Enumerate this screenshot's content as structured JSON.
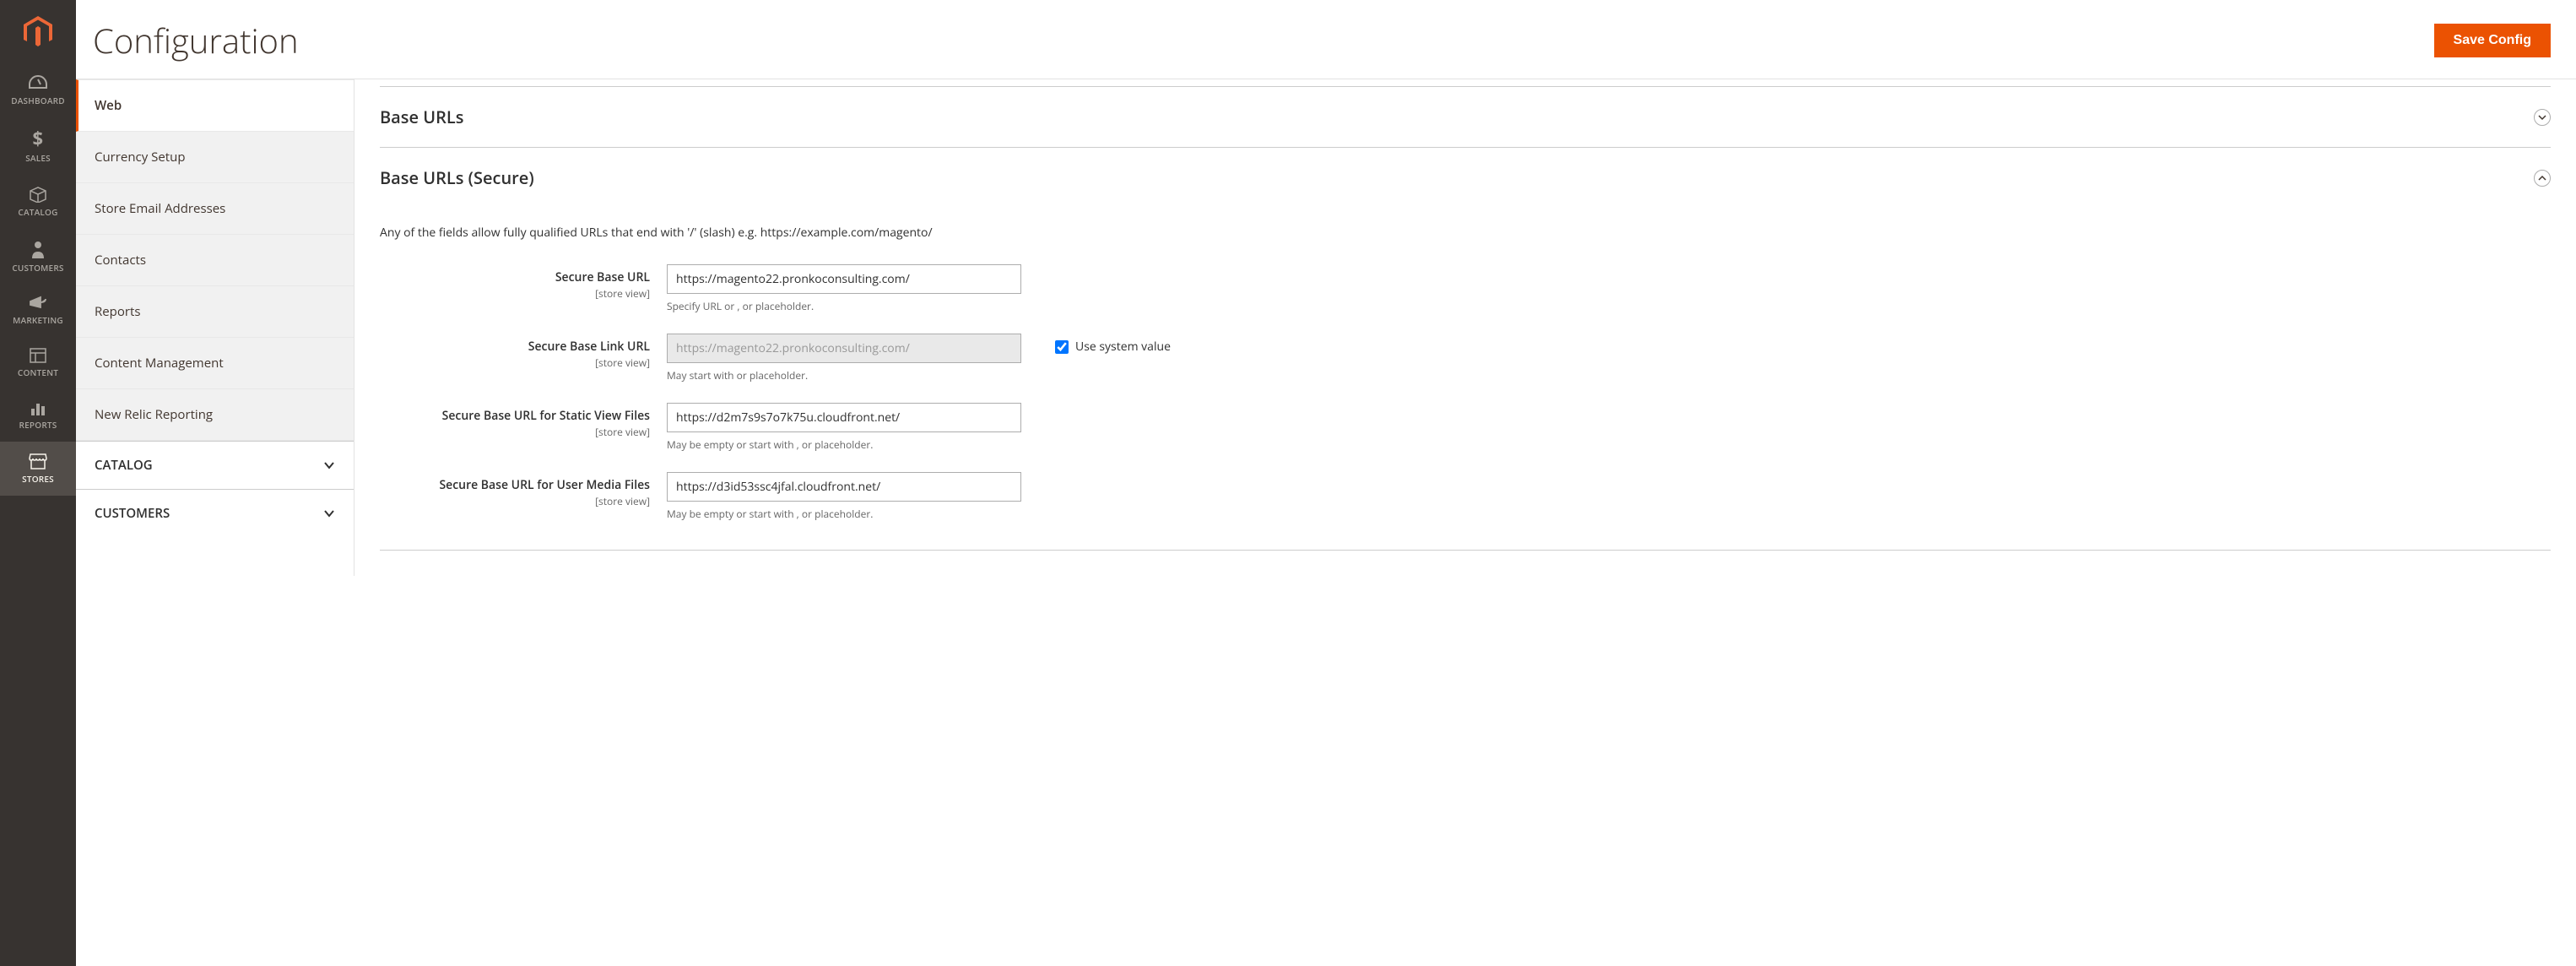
{
  "page": {
    "title": "Configuration",
    "save_label": "Save Config"
  },
  "nav": {
    "dashboard": "DASHBOARD",
    "sales": "SALES",
    "catalog": "CATALOG",
    "customers": "CUSTOMERS",
    "marketing": "MARKETING",
    "content": "CONTENT",
    "reports": "REPORTS",
    "stores": "STORES"
  },
  "tabs": {
    "web": "Web",
    "currency_setup": "Currency Setup",
    "store_emails": "Store Email Addresses",
    "contacts": "Contacts",
    "reports": "Reports",
    "content_mgmt": "Content Management",
    "new_relic": "New Relic Reporting",
    "catalog_group": "CATALOG",
    "customers_group": "CUSTOMERS"
  },
  "sections": {
    "base_urls": {
      "title": "Base URLs"
    },
    "base_urls_secure": {
      "title": "Base URLs (Secure)",
      "desc": "Any of the fields allow fully qualified URLs that end with '/' (slash) e.g. https://example.com/magento/",
      "fields": {
        "secure_base_url": {
          "label": "Secure Base URL",
          "scope": "[store view]",
          "value": "https://magento22.pronkoconsulting.com/",
          "hint": "Specify URL or , or placeholder."
        },
        "secure_base_link_url": {
          "label": "Secure Base Link URL",
          "scope": "[store view]",
          "value": "https://magento22.pronkoconsulting.com/",
          "hint": "May start with or placeholder.",
          "use_system_label": "Use system value"
        },
        "secure_base_static": {
          "label": "Secure Base URL for Static View Files",
          "scope": "[store view]",
          "value": "https://d2m7s9s7o7k75u.cloudfront.net/",
          "hint": "May be empty or start with , or placeholder."
        },
        "secure_base_media": {
          "label": "Secure Base URL for User Media Files",
          "scope": "[store view]",
          "value": "https://d3id53ssc4jfal.cloudfront.net/",
          "hint": "May be empty or start with , or placeholder."
        }
      }
    }
  }
}
